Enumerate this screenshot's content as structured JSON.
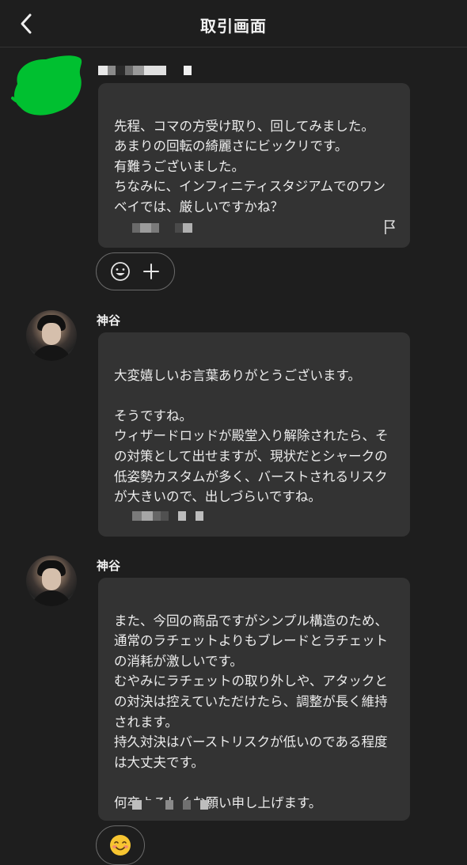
{
  "header": {
    "title": "取引画面"
  },
  "messages": [
    {
      "sender": "",
      "text": "先程、コマの方受け取り、回してみました。\nあまりの回転の綺麗さにビックリです。\n有難うございました。\nちなみに、インフィニティスタジアムでのワンベイでは、厳しいですかね？"
    },
    {
      "sender": "神谷",
      "text": "大変嬉しいお言葉ありがとうございます。\n\nそうですね。\nウィザードロッドが殿堂入り解除されたら、その対策として出せますが、現状だとシャークの低姿勢カスタムが多く、バーストされるリスクが大きいので、出しづらいですね。"
    },
    {
      "sender": "神谷",
      "text": "また、今回の商品ですがシンプル構造のため、通常のラチェットよりもブレードとラチェットの消耗が激しいです。\nむやみにラチェットの取り外しや、アタックとの対決は控えていただけたら、調整が長く維持されます。\n持久対決はバーストリスクが低いのである程度は大丈夫です。\n\n何卒よろしくお願い申し上げます。"
    }
  ],
  "icons": {
    "back": "chevron-left-icon",
    "flag": "flag-icon",
    "emoji": "smiley-icon",
    "add": "plus-icon",
    "reaction": "smiling-face-emoji"
  },
  "colors": {
    "background": "#1e1e1e",
    "bubble": "#333333",
    "redaction": "#00c030"
  }
}
